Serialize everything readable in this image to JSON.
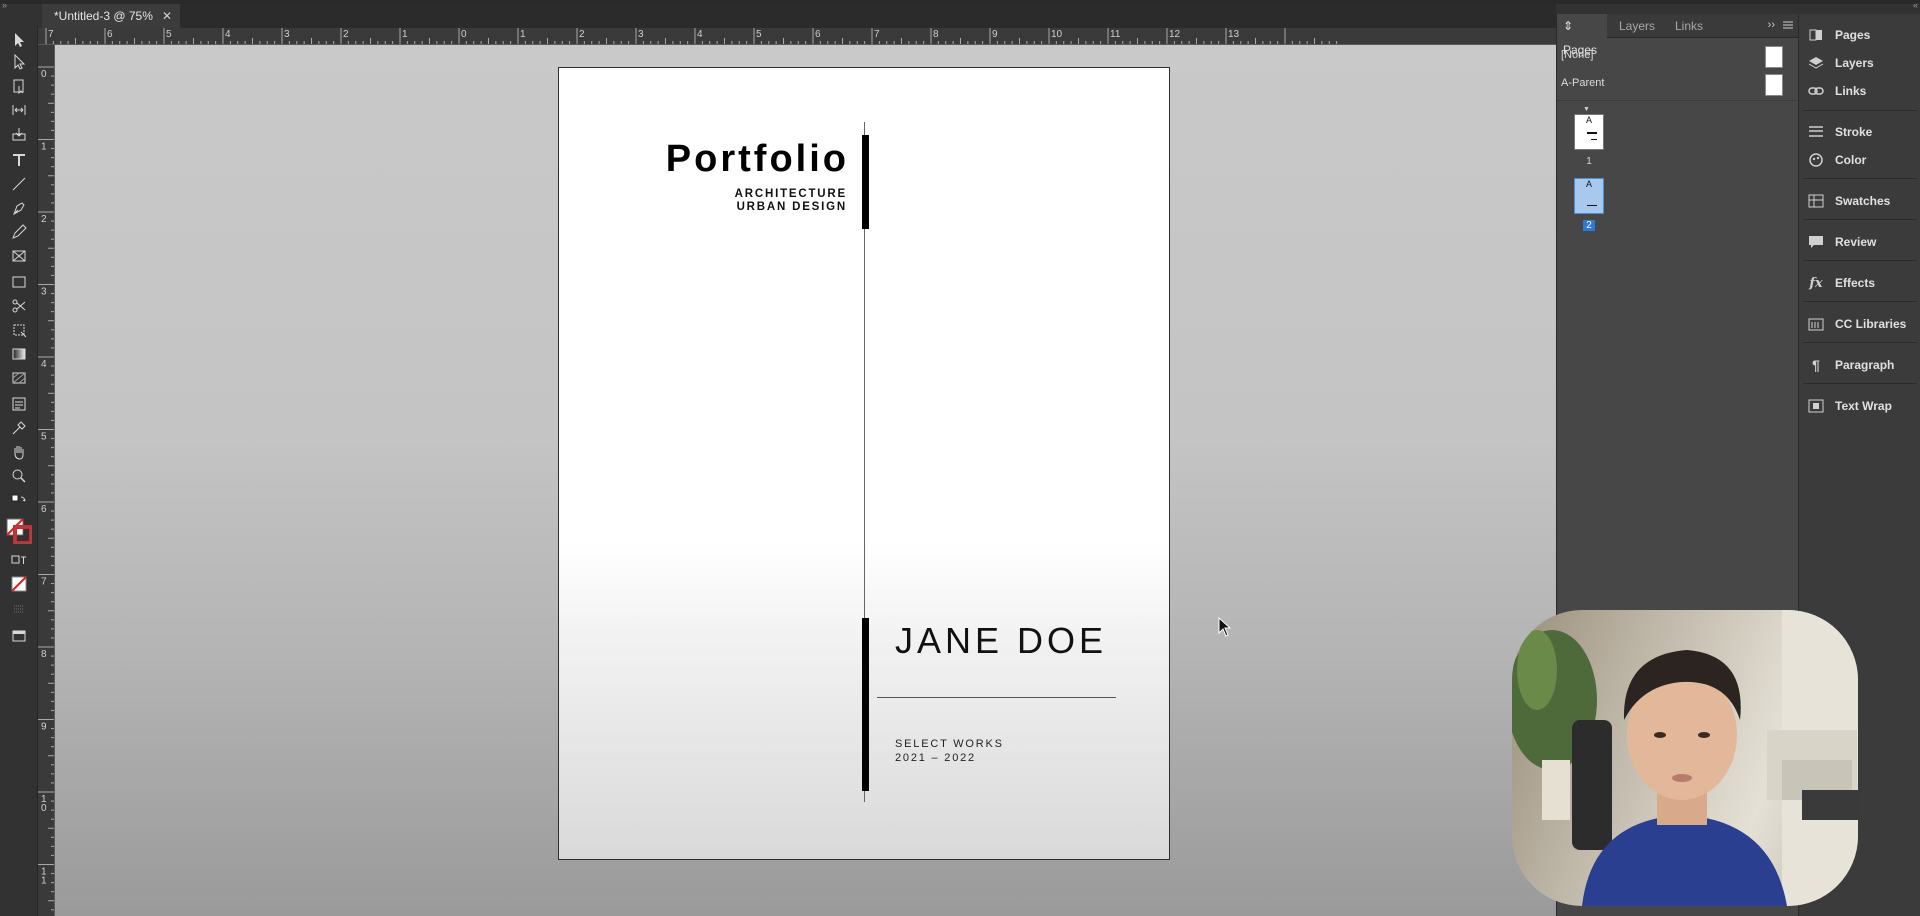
{
  "document_tab": {
    "title": "*Untitled-3 @ 75%",
    "close": "✕"
  },
  "toolbar": {
    "tools": [
      "selection-tool",
      "direct-selection-tool",
      "page-tool",
      "gap-tool",
      "content-collector-tool",
      "type-tool",
      "line-tool",
      "pen-tool",
      "pencil-tool",
      "rectangle-frame-tool",
      "rectangle-tool",
      "scissors-tool",
      "free-transform-tool",
      "gradient-swatch-tool",
      "gradient-feather-tool",
      "note-tool",
      "eyedropper-tool",
      "hand-tool",
      "zoom-tool"
    ]
  },
  "ruler_horizontal": [
    "7",
    "6",
    "5",
    "4",
    "3",
    "2",
    "1",
    "0",
    "1",
    "2",
    "3",
    "4",
    "5",
    "6",
    "7",
    "8",
    "9",
    "10",
    "11",
    "12",
    "13"
  ],
  "ruler_vertical": [
    "0",
    "1",
    "2",
    "3",
    "4",
    "5",
    "6",
    "7",
    "8",
    "9",
    "1 0",
    "1 1"
  ],
  "document": {
    "title": "Portfolio",
    "subtitle_line1": "ARCHITECTURE",
    "subtitle_line2": "URBAN DESIGN",
    "name": "JANE DOE",
    "works_line1": "SELECT WORKS",
    "works_line2": "2021 – 2022"
  },
  "pages_panel": {
    "tabs": [
      "Pages",
      "Layers",
      "Links"
    ],
    "tabs_arrows": "››",
    "masters": [
      "[None]",
      "A-Parent"
    ],
    "pages": [
      {
        "prefix": "A",
        "number": "1",
        "selected": false
      },
      {
        "prefix": "A",
        "number": "2",
        "selected": true
      }
    ]
  },
  "dock": {
    "items": [
      {
        "label": "Pages",
        "icon": "pages-icon"
      },
      {
        "label": "Layers",
        "icon": "layers-icon"
      },
      {
        "label": "Links",
        "icon": "links-icon"
      },
      {
        "label": "Stroke",
        "icon": "stroke-icon"
      },
      {
        "label": "Color",
        "icon": "color-icon"
      },
      {
        "label": "Swatches",
        "icon": "swatches-icon"
      },
      {
        "label": "Review",
        "icon": "review-icon"
      },
      {
        "label": "Effects",
        "icon": "fx-icon"
      },
      {
        "label": "CC Libraries",
        "icon": "cc-libraries-icon"
      },
      {
        "label": "Paragraph",
        "icon": "paragraph-icon"
      },
      {
        "label": "Text Wrap",
        "icon": "text-wrap-icon"
      }
    ]
  },
  "colors": {
    "selected_page": "#4a90d9",
    "panel": "#474747",
    "dock": "#3b3b3b",
    "pasteboard": "#c4c4c4"
  }
}
